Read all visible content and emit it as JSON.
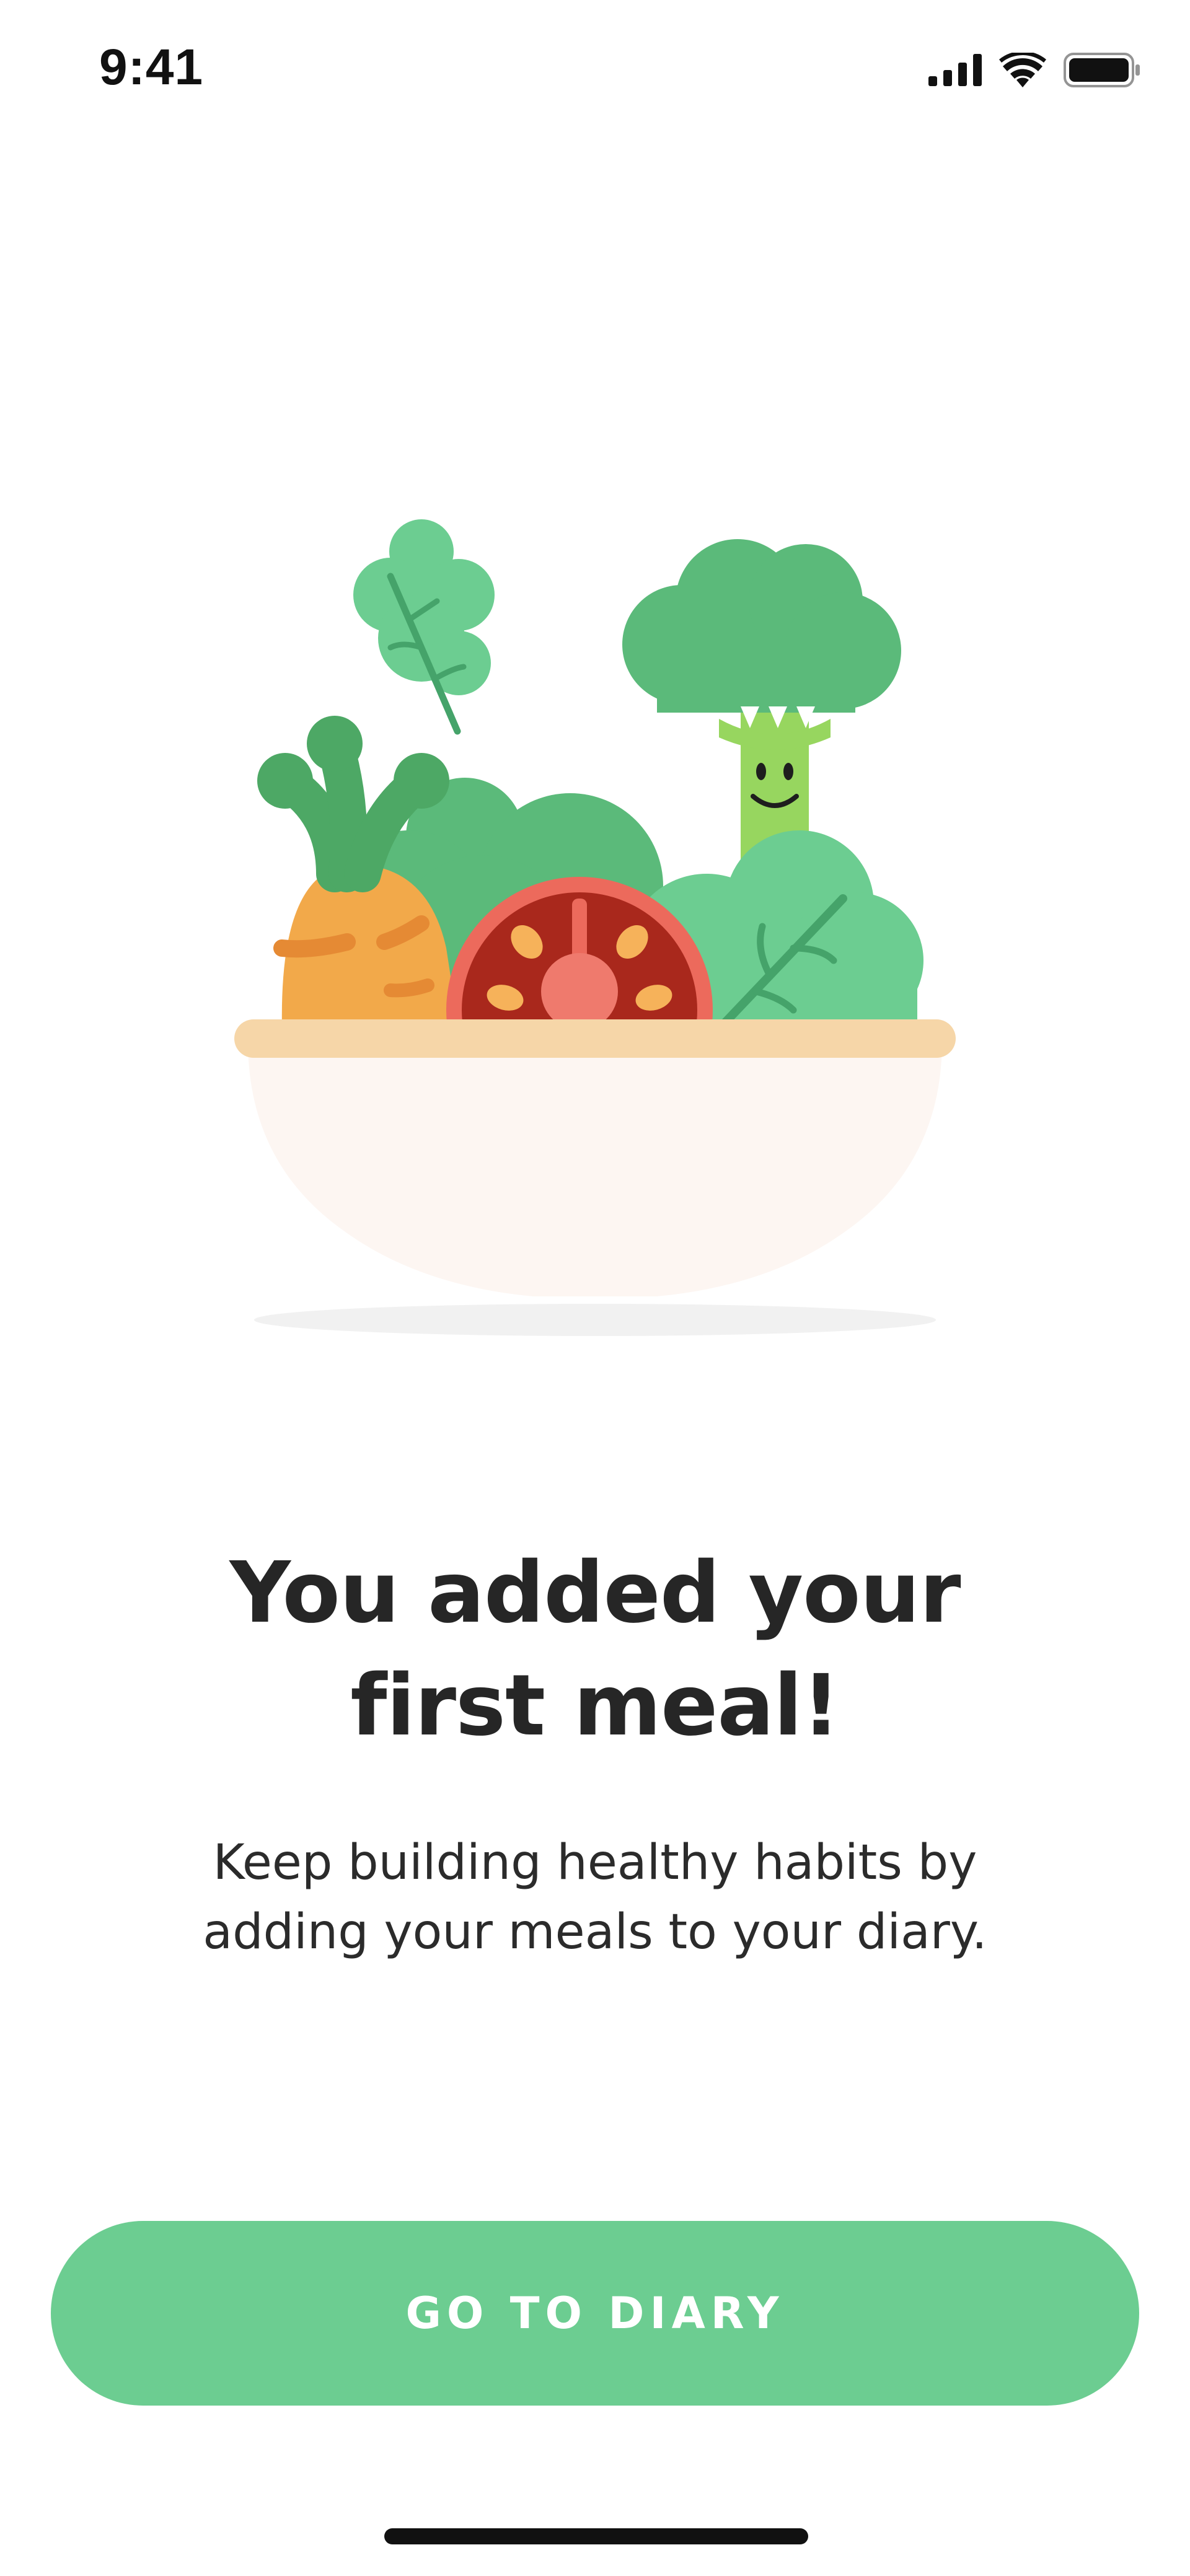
{
  "status_bar": {
    "time": "9:41",
    "icons": [
      "cellular-signal-icon",
      "wifi-icon",
      "battery-icon"
    ]
  },
  "illustration": {
    "subject": "salad-bowl-illustration",
    "items": [
      "carrot-icon",
      "lettuce-leaf-icon",
      "tomato-slice-icon",
      "broccoli-character-icon",
      "spinach-leaf-icon",
      "bowl-icon"
    ]
  },
  "content": {
    "headline_line1": "You added your",
    "headline_line2": "first meal!",
    "subtitle_line1": "Keep building healthy habits by",
    "subtitle_line2": "adding your meals to your diary."
  },
  "actions": {
    "primary_label": "GO TO DIARY"
  },
  "colors": {
    "accent": "#6ccd91",
    "text": "#262626",
    "background": "#ffffff"
  }
}
